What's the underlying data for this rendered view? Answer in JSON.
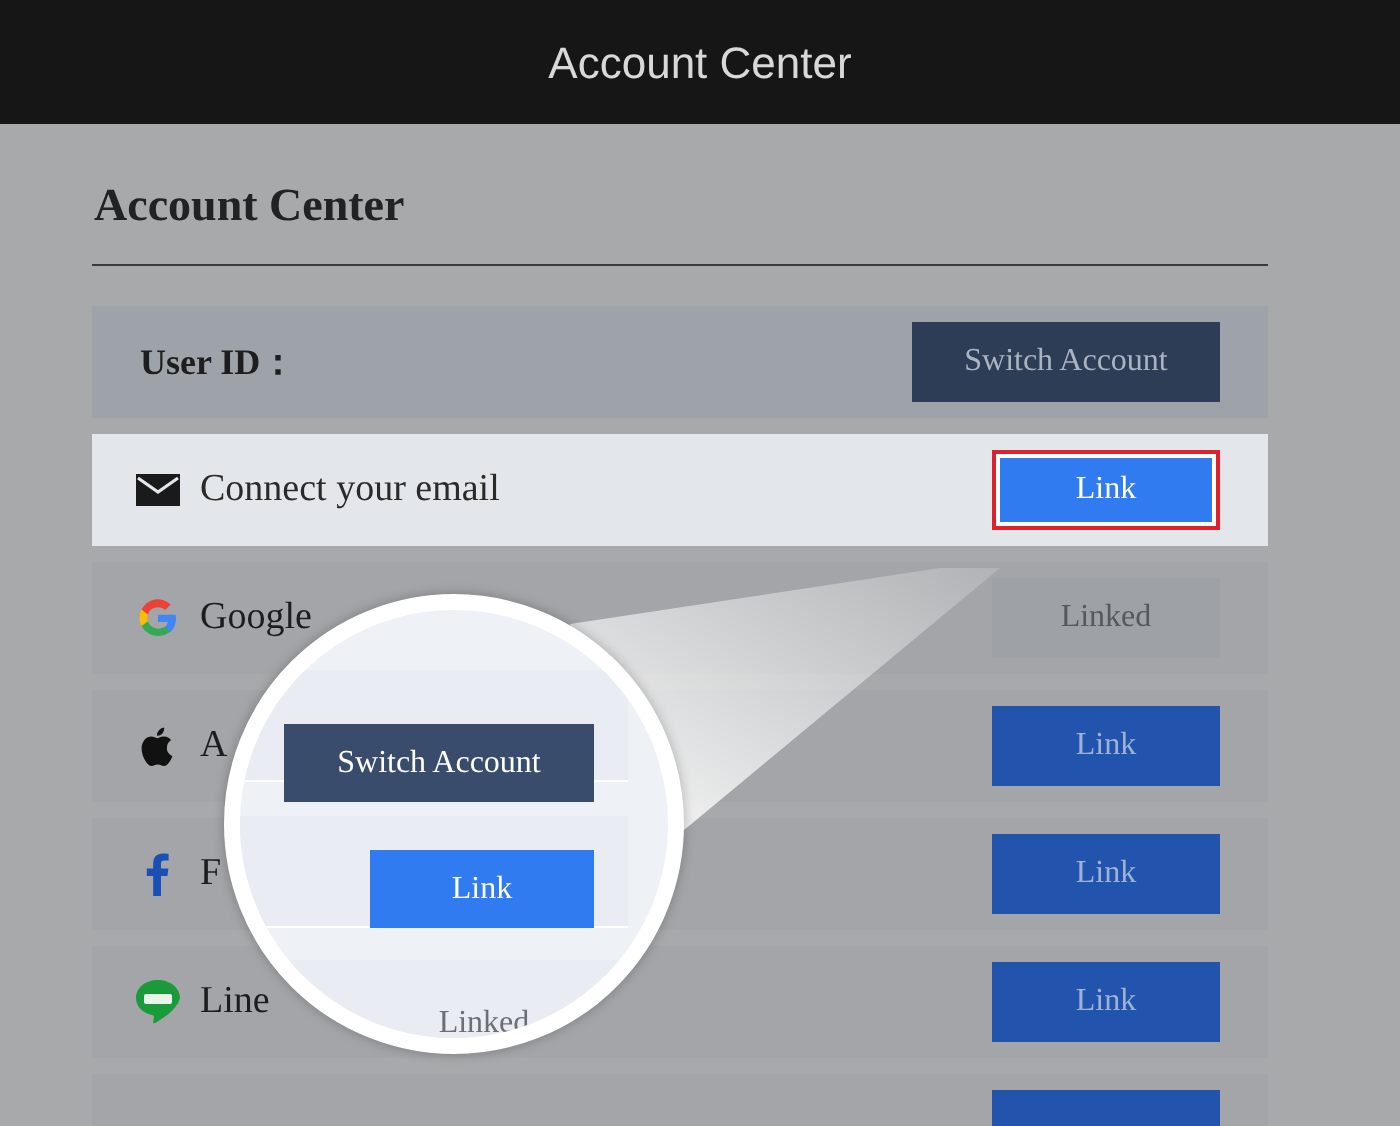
{
  "header": {
    "title": "Account Center"
  },
  "panel": {
    "title": "Account Center"
  },
  "user_row": {
    "label": "User ID：",
    "button": "Switch Account"
  },
  "rows": [
    {
      "kind": "mail",
      "label": "Connect your email",
      "highlighted": true,
      "button": {
        "kind": "link",
        "label": "Link",
        "outlined": true
      }
    },
    {
      "kind": "google",
      "label": "Google",
      "highlighted": false,
      "button": {
        "kind": "linked",
        "label": "Linked",
        "outlined": false
      }
    },
    {
      "kind": "apple",
      "label": "A",
      "highlighted": false,
      "button": {
        "kind": "link",
        "label": "Link",
        "outlined": false
      }
    },
    {
      "kind": "facebook",
      "label": "F",
      "highlighted": false,
      "button": {
        "kind": "link",
        "label": "Link",
        "outlined": false
      }
    },
    {
      "kind": "line",
      "label": "Line",
      "highlighted": false,
      "button": {
        "kind": "link",
        "label": "Link",
        "outlined": false
      }
    },
    {
      "kind": "blank",
      "highlighted": false,
      "button": {
        "kind": "link",
        "outlined": false
      }
    }
  ],
  "magnifier": {
    "items": [
      {
        "kind": "switch",
        "label": "Switch Account"
      },
      {
        "kind": "link",
        "label": "Link"
      },
      {
        "kind": "linked",
        "label": "Linked"
      }
    ]
  }
}
